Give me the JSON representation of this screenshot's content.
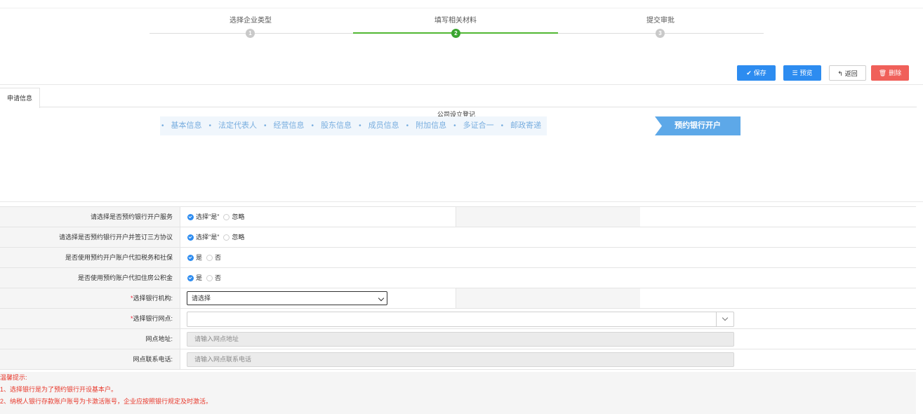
{
  "steps": [
    {
      "title": "选择企业类型",
      "num": "1",
      "active": false
    },
    {
      "title": "填写相关材料",
      "num": "2",
      "active": true
    },
    {
      "title": "提交审批",
      "num": "3",
      "active": false
    }
  ],
  "toolbar": {
    "save_label": "保存",
    "preview_label": "预览",
    "back_label": "返回",
    "delete_label": "删除"
  },
  "tab": {
    "label": "申请信息"
  },
  "section_title": "公司设立登记",
  "flow": {
    "items": [
      "基本信息",
      "法定代表人",
      "经营信息",
      "股东信息",
      "成员信息",
      "附加信息",
      "多证合一",
      "邮政寄递"
    ],
    "active": "预约银行开户"
  },
  "form": {
    "row1": {
      "label": "请选择是否预约银行开户服务",
      "opt_yes": "选择\"是\"",
      "opt_no": "忽略"
    },
    "row2": {
      "label": "请选择是否预约银行开户并签订三方协议",
      "opt_yes": "选择\"是\"",
      "opt_no": "忽略"
    },
    "row3": {
      "label": "是否使用预约开户账户代扣税务和社保",
      "opt_yes": "是",
      "opt_no": "否"
    },
    "row4": {
      "label": "是否使用预约账户代扣住房公积金",
      "opt_yes": "是",
      "opt_no": "否"
    },
    "row5": {
      "label": "选择银行机构:",
      "required_mark": "*",
      "select_value": "请选择"
    },
    "row6": {
      "label": "选择银行网点:",
      "required_mark": "*",
      "value": ""
    },
    "row7": {
      "label": "网点地址:",
      "placeholder": "请输入网点地址"
    },
    "row8": {
      "label": "网点联系电话:",
      "placeholder": "请输入网点联系电话"
    }
  },
  "tips": {
    "title": "温馨提示:",
    "line1": "1、选择银行是为了预约银行开设基本户。",
    "line2": "2、纳税人银行存款账户账号为卡激活账号，企业应按照银行规定及时激活。"
  },
  "colors": {
    "primary": "#2d8cf0",
    "danger": "#f0605a",
    "step_active": "#52b733",
    "flow_active": "#5da8e8",
    "tip_text": "#e8382b"
  }
}
